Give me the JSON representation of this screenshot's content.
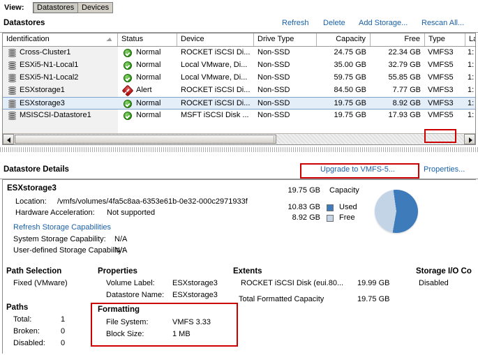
{
  "view_bar": {
    "label": "View:",
    "buttons": [
      {
        "label": "Datastores",
        "selected": true
      },
      {
        "label": "Devices",
        "selected": false
      }
    ]
  },
  "datastores_panel": {
    "title": "Datastores",
    "actions": {
      "refresh": "Refresh",
      "delete": "Delete",
      "add_storage": "Add Storage...",
      "rescan_all": "Rescan All..."
    },
    "columns": [
      "Identification",
      "Status",
      "Device",
      "Drive Type",
      "Capacity",
      "Free",
      "Type",
      "La"
    ],
    "rows": [
      {
        "identification": "Cross-Cluster1",
        "status": "Normal",
        "status_kind": "normal",
        "device": "ROCKET iSCSI Di...",
        "drive_type": "Non-SSD",
        "capacity": "24.75 GB",
        "free": "22.34 GB",
        "type": "VMFS3",
        "last_update": "1:",
        "selected": false
      },
      {
        "identification": "ESXi5-N1-Local1",
        "status": "Normal",
        "status_kind": "normal",
        "device": "Local VMware, Di...",
        "drive_type": "Non-SSD",
        "capacity": "35.00 GB",
        "free": "32.79 GB",
        "type": "VMFS5",
        "last_update": "1:",
        "selected": false
      },
      {
        "identification": "ESXi5-N1-Local2",
        "status": "Normal",
        "status_kind": "normal",
        "device": "Local VMware, Di...",
        "drive_type": "Non-SSD",
        "capacity": "59.75 GB",
        "free": "55.85 GB",
        "type": "VMFS5",
        "last_update": "1:",
        "selected": false
      },
      {
        "identification": "ESXstorage1",
        "status": "Alert",
        "status_kind": "alert",
        "device": "ROCKET iSCSI Di...",
        "drive_type": "Non-SSD",
        "capacity": "84.50 GB",
        "free": "7.77 GB",
        "type": "VMFS3",
        "last_update": "1:",
        "selected": false
      },
      {
        "identification": "ESXstorage3",
        "status": "Normal",
        "status_kind": "normal",
        "device": "ROCKET iSCSI Di...",
        "drive_type": "Non-SSD",
        "capacity": "19.75 GB",
        "free": "8.92 GB",
        "type": "VMFS3",
        "last_update": "1:",
        "selected": true
      },
      {
        "identification": "MSISCSI-Datastore1",
        "status": "Normal",
        "status_kind": "normal",
        "device": "MSFT iSCSI Disk ...",
        "drive_type": "Non-SSD",
        "capacity": "19.75 GB",
        "free": "17.93 GB",
        "type": "VMFS5",
        "last_update": "1:",
        "selected": false
      }
    ]
  },
  "details": {
    "title": "Datastore Details",
    "actions": {
      "upgrade": "Upgrade to VMFS-5...",
      "properties": "Properties..."
    },
    "name": "ESXstorage3",
    "location_label": "Location:",
    "location_value": "/vmfs/volumes/4fa5c8aa-6353e61b-0e32-000c2971933f",
    "hw_accel_label": "Hardware Acceleration:",
    "hw_accel_value": "Not supported",
    "refresh_caps_link": "Refresh Storage Capabilities",
    "sys_cap_label": "System Storage Capability:",
    "sys_cap_value": "N/A",
    "user_cap_label": "User-defined Storage Capability:",
    "user_cap_value": "N/A",
    "capacity": {
      "total_value": "19.75 GB",
      "total_label": "Capacity",
      "used_value": "10.83 GB",
      "used_label": "Used",
      "free_value": "8.92 GB",
      "free_label": "Free",
      "used_color": "#3d7bba",
      "free_color": "#c4d5e8",
      "used_fraction": 0.55
    },
    "path_selection": {
      "heading": "Path Selection",
      "value": "Fixed (VMware)"
    },
    "paths": {
      "heading": "Paths",
      "total_label": "Total:",
      "total_value": "1",
      "broken_label": "Broken:",
      "broken_value": "0",
      "disabled_label": "Disabled:",
      "disabled_value": "0"
    },
    "properties": {
      "heading": "Properties",
      "volume_label_key": "Volume Label:",
      "volume_label_value": "ESXstorage3",
      "datastore_name_key": "Datastore Name:",
      "datastore_name_value": "ESXstorage3"
    },
    "formatting": {
      "heading": "Formatting",
      "file_system_key": "File System:",
      "file_system_value": "VMFS 3.33",
      "block_size_key": "Block Size:",
      "block_size_value": "1 MB"
    },
    "extents": {
      "heading": "Extents",
      "device_name": "ROCKET iSCSI Disk (eui.80...",
      "device_size": "19.99 GB",
      "total_label": "Total Formatted Capacity",
      "total_value": "19.75 GB"
    },
    "storage_io": {
      "heading": "Storage I/O Co",
      "value": "Disabled"
    }
  },
  "highlights": {
    "color": "#cc0000",
    "regions": [
      "type-cell-vmfs3",
      "upgrade-to-vmfs5-link",
      "formatting-section"
    ]
  }
}
